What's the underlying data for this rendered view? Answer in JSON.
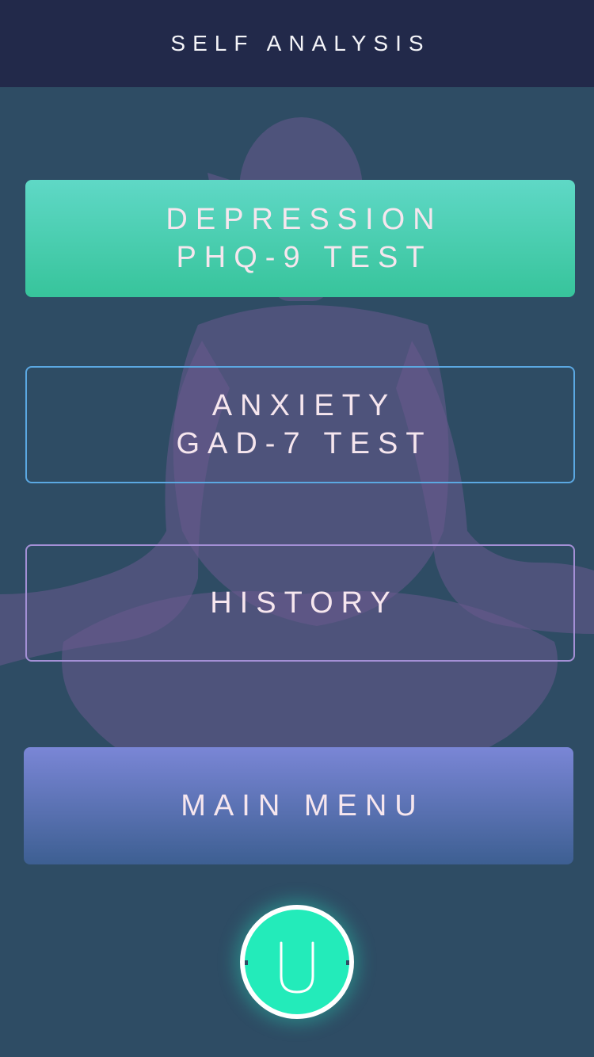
{
  "header": {
    "title": "SELF ANALYSIS"
  },
  "buttons": {
    "depression": {
      "line1": "DEPRESSION",
      "line2": "PHQ-9 TEST"
    },
    "anxiety": {
      "line1": "ANXIETY",
      "line2": "GAD-7 TEST"
    },
    "history": {
      "label": "HISTORY"
    },
    "main_menu": {
      "label": "MAIN MENU"
    }
  },
  "fab": {
    "icon": "u-shape-icon"
  },
  "background": {
    "image": "meditation-silhouette"
  },
  "colors": {
    "header_bg": "#22294a",
    "page_bg": "#2e4c64",
    "silhouette": "#6a5a8e",
    "fab_fill": "#23ebba",
    "border_green": "#44ccaa",
    "border_blue": "#5ba8e2",
    "border_purple": "#a490d6",
    "border_indigo": "#6a78c8",
    "text": "#f6e6ee"
  }
}
